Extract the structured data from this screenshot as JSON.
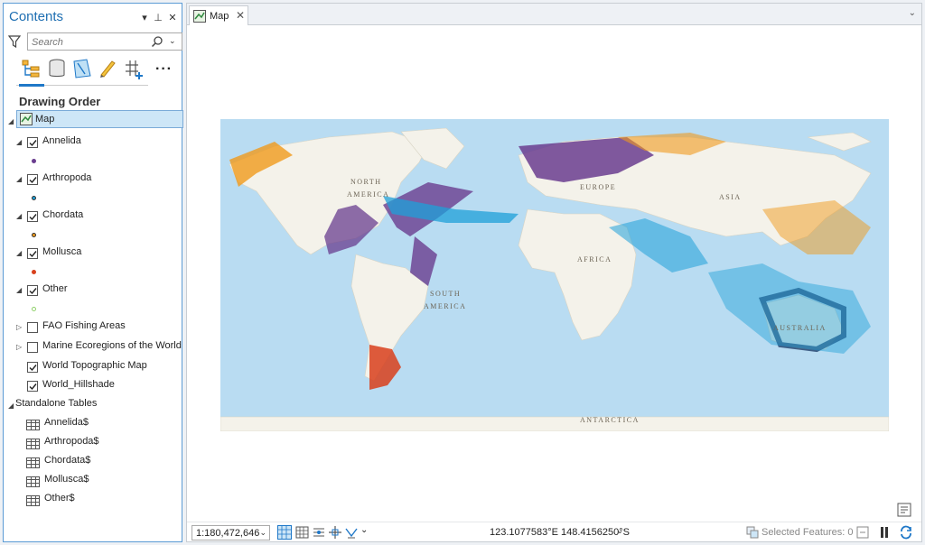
{
  "contents": {
    "title": "Contents",
    "search_placeholder": "Search",
    "section_title": "Drawing Order",
    "map_label": "Map",
    "layers": [
      {
        "label": "Annelida",
        "checked": true,
        "symbol_color": "#6a3d8f"
      },
      {
        "label": "Arthropoda",
        "checked": true,
        "symbol_color": "#1fa0d8"
      },
      {
        "label": "Chordata",
        "checked": true,
        "symbol_color": "#f09a1c"
      },
      {
        "label": "Mollusca",
        "checked": true,
        "symbol_color": "#d8401c"
      },
      {
        "label": "Other",
        "checked": true,
        "symbol_color": "#8fd06a"
      }
    ],
    "basemap_layers": [
      {
        "label": "FAO Fishing Areas",
        "checked": false
      },
      {
        "label": "Marine Ecoregions of the World",
        "checked": false
      },
      {
        "label": "World Topographic Map",
        "checked": true
      },
      {
        "label": "World_Hillshade",
        "checked": true
      }
    ],
    "standalone_title": "Standalone Tables",
    "tables": [
      "Annelida$",
      "Arthropoda$",
      "Chordata$",
      "Mollusca$",
      "Other$"
    ]
  },
  "map_tab": {
    "label": "Map",
    "close": "✕"
  },
  "map_labels": {
    "north_america_1": "NORTH",
    "north_america_2": "AMERICA",
    "south_america_1": "SOUTH",
    "south_america_2": "AMERICA",
    "europe": "EUROPE",
    "asia": "ASIA",
    "africa": "AFRICA",
    "australia": "AUSTRALIA",
    "antarctica": "ANTARCTICA"
  },
  "status": {
    "scale": "1:180,472,646",
    "coordinates": "123.1077583°E 148.4156250°S",
    "selected_features": "Selected Features: 0"
  },
  "colors": {
    "accent": "#1f78c8",
    "ocean": "#b9dcf2",
    "land": "#f4f2ea"
  }
}
